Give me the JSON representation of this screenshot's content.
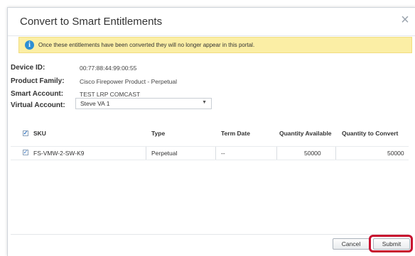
{
  "dialog": {
    "title": "Convert to Smart Entitlements",
    "banner_text": "Once these entitlements have been converted they will no longer appear in this portal."
  },
  "fields": {
    "device_id_label": "Device ID:",
    "device_id_value": "00:77:88:44:99:00:55",
    "product_family_label": "Product Family:",
    "product_family_value": "Cisco Firepower Product - Perpetual",
    "smart_account_label": "Smart Account:",
    "smart_account_value": "TEST LRP COMCAST",
    "virtual_account_label": "Virtual Account:",
    "virtual_account_value": "Steve VA 1"
  },
  "table": {
    "headers": [
      "SKU",
      "Type",
      "Term Date",
      "Quantity Available",
      "Quantity to Convert"
    ],
    "rows": [
      [
        "FS-VMW-2-SW-K9",
        "Perpetual",
        "--",
        "50000",
        "50000"
      ]
    ]
  },
  "buttons": {
    "cancel": "Cancel",
    "submit": "Submit"
  },
  "colors": {
    "banner_bg": "#fbeea5",
    "highlight": "#c8102e",
    "info_icon": "#2d8ed3"
  }
}
